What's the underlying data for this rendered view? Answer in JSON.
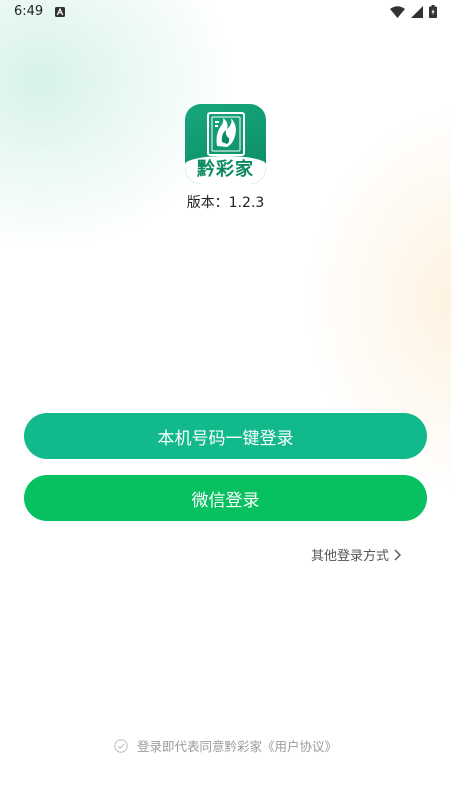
{
  "status_bar": {
    "time": "6:49",
    "icons": [
      "a-notification-icon",
      "wifi-icon",
      "signal-icon",
      "battery-icon"
    ]
  },
  "app": {
    "logo_caption": "黔彩家",
    "version_label": "版本：1.2.3"
  },
  "login": {
    "phone_button_label": "本机号码一键登录",
    "wechat_button_label": "微信登录",
    "other_methods_label": "其他登录方式"
  },
  "agreement": {
    "text": "登录即代表同意黔彩家《用户协议》"
  },
  "colors": {
    "logo_green": "#0d8a63",
    "phone_button": "#12b98c",
    "wechat_button": "#07c160"
  }
}
